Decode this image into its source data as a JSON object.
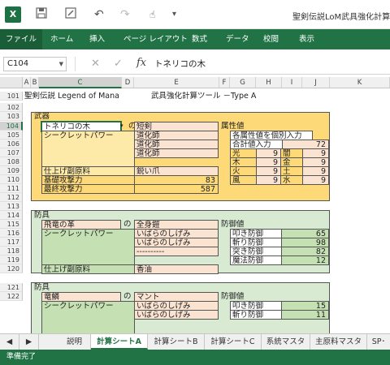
{
  "app": {
    "title": "聖剣伝説LoM武具強化計算機"
  },
  "ribbon": {
    "tabs": [
      "ファイル",
      "ホーム",
      "挿入",
      "ページ レイアウト",
      "数式",
      "データ",
      "校閲",
      "表示"
    ]
  },
  "formula_bar": {
    "name_box": "C104",
    "fx": "fx",
    "content": "トネリコの木"
  },
  "grid": {
    "columns": [
      "A",
      "B",
      "C",
      "D",
      "E",
      "F",
      "G",
      "H",
      "I",
      "J",
      "K"
    ],
    "selected_column": "C",
    "rows": [
      "101",
      "102",
      "103",
      "104",
      "105",
      "106",
      "107",
      "108",
      "109",
      "110",
      "111",
      "112",
      "113",
      "114",
      "115",
      "116",
      "117",
      "118",
      "119",
      "120",
      "121",
      "122"
    ],
    "selected_row": "104",
    "title_text": "聖剣伝説 Legend of Mana",
    "title_tool": "武具強化計算ツール －Type A",
    "weapon": {
      "section": "武器",
      "material": "トネリコの木",
      "type": "短剣",
      "secret_label": "シークレットパワー",
      "secrets": [
        "道化師",
        "道化師",
        "道化師"
      ],
      "finish_label": "仕上げ副原料",
      "finish": "鋭い爪",
      "base_label": "基礎攻撃力",
      "base": "83",
      "final_label": "最終攻撃力",
      "final": "587",
      "attr_label": "属性値",
      "attr_individual": "各属性値を個別入力",
      "attr_total_label": "合計値入力",
      "attr_total": "72",
      "attrs": [
        {
          "n1": "光",
          "v1": "9",
          "n2": "闇",
          "v2": "9"
        },
        {
          "n1": "木",
          "v1": "9",
          "n2": "金",
          "v2": "9"
        },
        {
          "n1": "火",
          "v1": "9",
          "n2": "土",
          "v2": "9"
        },
        {
          "n1": "風",
          "v1": "9",
          "n2": "水",
          "v2": "9"
        }
      ]
    },
    "armor1": {
      "section": "防具",
      "material": "飛竜の革",
      "of": "の",
      "type": "全身鎧",
      "secret_label": "シークレットパワー",
      "secrets": [
        "いばらのしげみ",
        "いばらのしげみ",
        "----------"
      ],
      "finish_label": "仕上げ副原料",
      "finish": "香油",
      "def_label": "防御値",
      "defs": [
        {
          "n": "叩き防御",
          "v": "65"
        },
        {
          "n": "斬り防御",
          "v": "98"
        },
        {
          "n": "突き防御",
          "v": "82"
        },
        {
          "n": "魔法防御",
          "v": "12"
        }
      ]
    },
    "armor2": {
      "section": "防具",
      "material": "竜鱗",
      "of": "の",
      "type": "マント",
      "secret_label": "シークレットパワー",
      "secrets": [
        "いばらのしげみ",
        "いばらのしげみ"
      ],
      "def_label": "防御値",
      "defs": [
        {
          "n": "叩き防御",
          "v": "15"
        },
        {
          "n": "斬り防御",
          "v": "11"
        }
      ]
    }
  },
  "sheets": {
    "tabs": [
      "説明",
      "計算シートA",
      "計算シートB",
      "計算シートC",
      "系統マスタ",
      "主原料マスタ",
      "SP･"
    ],
    "active": "計算シートA"
  },
  "status": {
    "text": "準備完了"
  },
  "colors": {
    "accent": "#217346",
    "yellow": "#fdd978",
    "pink": "#fbe3d2",
    "green": "#c5e0b3"
  },
  "icons": [
    "excel-icon",
    "save-icon",
    "edit-icon",
    "undo-icon",
    "redo-icon",
    "touch-icon",
    "customize-icon",
    "cancel-icon",
    "enter-icon",
    "function-icon"
  ]
}
